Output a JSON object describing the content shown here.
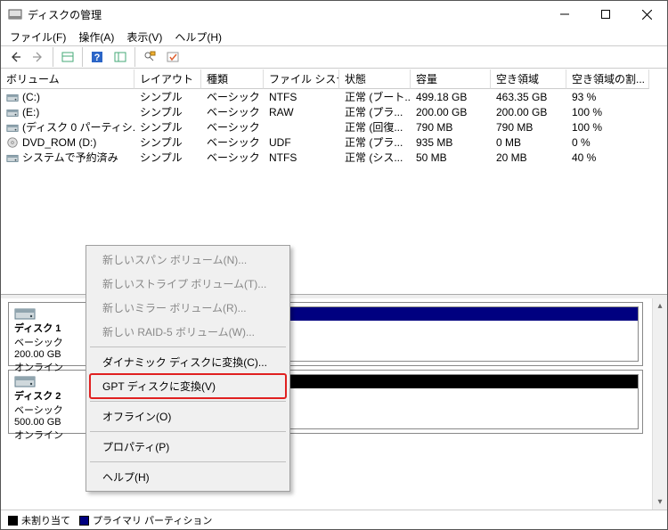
{
  "title": "ディスクの管理",
  "menubar": [
    "ファイル(F)",
    "操作(A)",
    "表示(V)",
    "ヘルプ(H)"
  ],
  "columns": [
    "ボリューム",
    "レイアウト",
    "種類",
    "ファイル システム",
    "状態",
    "容量",
    "空き領域",
    "空き領域の割..."
  ],
  "volumes": [
    {
      "icon": "drive",
      "name": "(C:)",
      "layout": "シンプル",
      "type": "ベーシック",
      "fs": "NTFS",
      "status": "正常 (ブート...",
      "cap": "499.18 GB",
      "free": "463.35 GB",
      "pct": "93 %"
    },
    {
      "icon": "drive",
      "name": "(E:)",
      "layout": "シンプル",
      "type": "ベーシック",
      "fs": "RAW",
      "status": "正常 (プラ...",
      "cap": "200.00 GB",
      "free": "200.00 GB",
      "pct": "100 %"
    },
    {
      "icon": "drive",
      "name": "(ディスク 0 パーティシ...",
      "layout": "シンプル",
      "type": "ベーシック",
      "fs": "",
      "status": "正常 (回復...",
      "cap": "790 MB",
      "free": "790 MB",
      "pct": "100 %"
    },
    {
      "icon": "disc",
      "name": "DVD_ROM (D:)",
      "layout": "シンプル",
      "type": "ベーシック",
      "fs": "UDF",
      "status": "正常 (プラ...",
      "cap": "935 MB",
      "free": "0 MB",
      "pct": "0 %"
    },
    {
      "icon": "drive",
      "name": "システムで予約済み",
      "layout": "シンプル",
      "type": "ベーシック",
      "fs": "NTFS",
      "status": "正常 (シス...",
      "cap": "50 MB",
      "free": "20 MB",
      "pct": "40 %"
    }
  ],
  "disks": [
    {
      "name": "ディスク 1",
      "kind": "ベーシック",
      "size": "200.00 GB",
      "state": "オンライン",
      "barColor": "#000080",
      "p_title": "",
      "p_sub": ""
    },
    {
      "name": "ディスク 2",
      "kind": "ベーシック",
      "size": "500.00 GB",
      "state": "オンライン",
      "barColor": "#000000",
      "p_title": "",
      "p_sub": ""
    }
  ],
  "legend": {
    "unalloc": {
      "color": "#000000",
      "label": "未割り当て"
    },
    "primary": {
      "color": "#000080",
      "label": "プライマリ パーティション"
    }
  },
  "context_menu": [
    {
      "label": "新しいスパン ボリューム(N)...",
      "enabled": false
    },
    {
      "label": "新しいストライプ ボリューム(T)...",
      "enabled": false
    },
    {
      "label": "新しいミラー ボリューム(R)...",
      "enabled": false
    },
    {
      "label": "新しい RAID-5 ボリューム(W)...",
      "enabled": false
    },
    {
      "sep": true
    },
    {
      "label": "ダイナミック ディスクに変換(C)...",
      "enabled": true
    },
    {
      "label": "GPT ディスクに変換(V)",
      "enabled": true,
      "highlight": true
    },
    {
      "sep": true
    },
    {
      "label": "オフライン(O)",
      "enabled": true
    },
    {
      "sep": true
    },
    {
      "label": "プロパティ(P)",
      "enabled": true
    },
    {
      "sep": true
    },
    {
      "label": "ヘルプ(H)",
      "enabled": true
    }
  ]
}
